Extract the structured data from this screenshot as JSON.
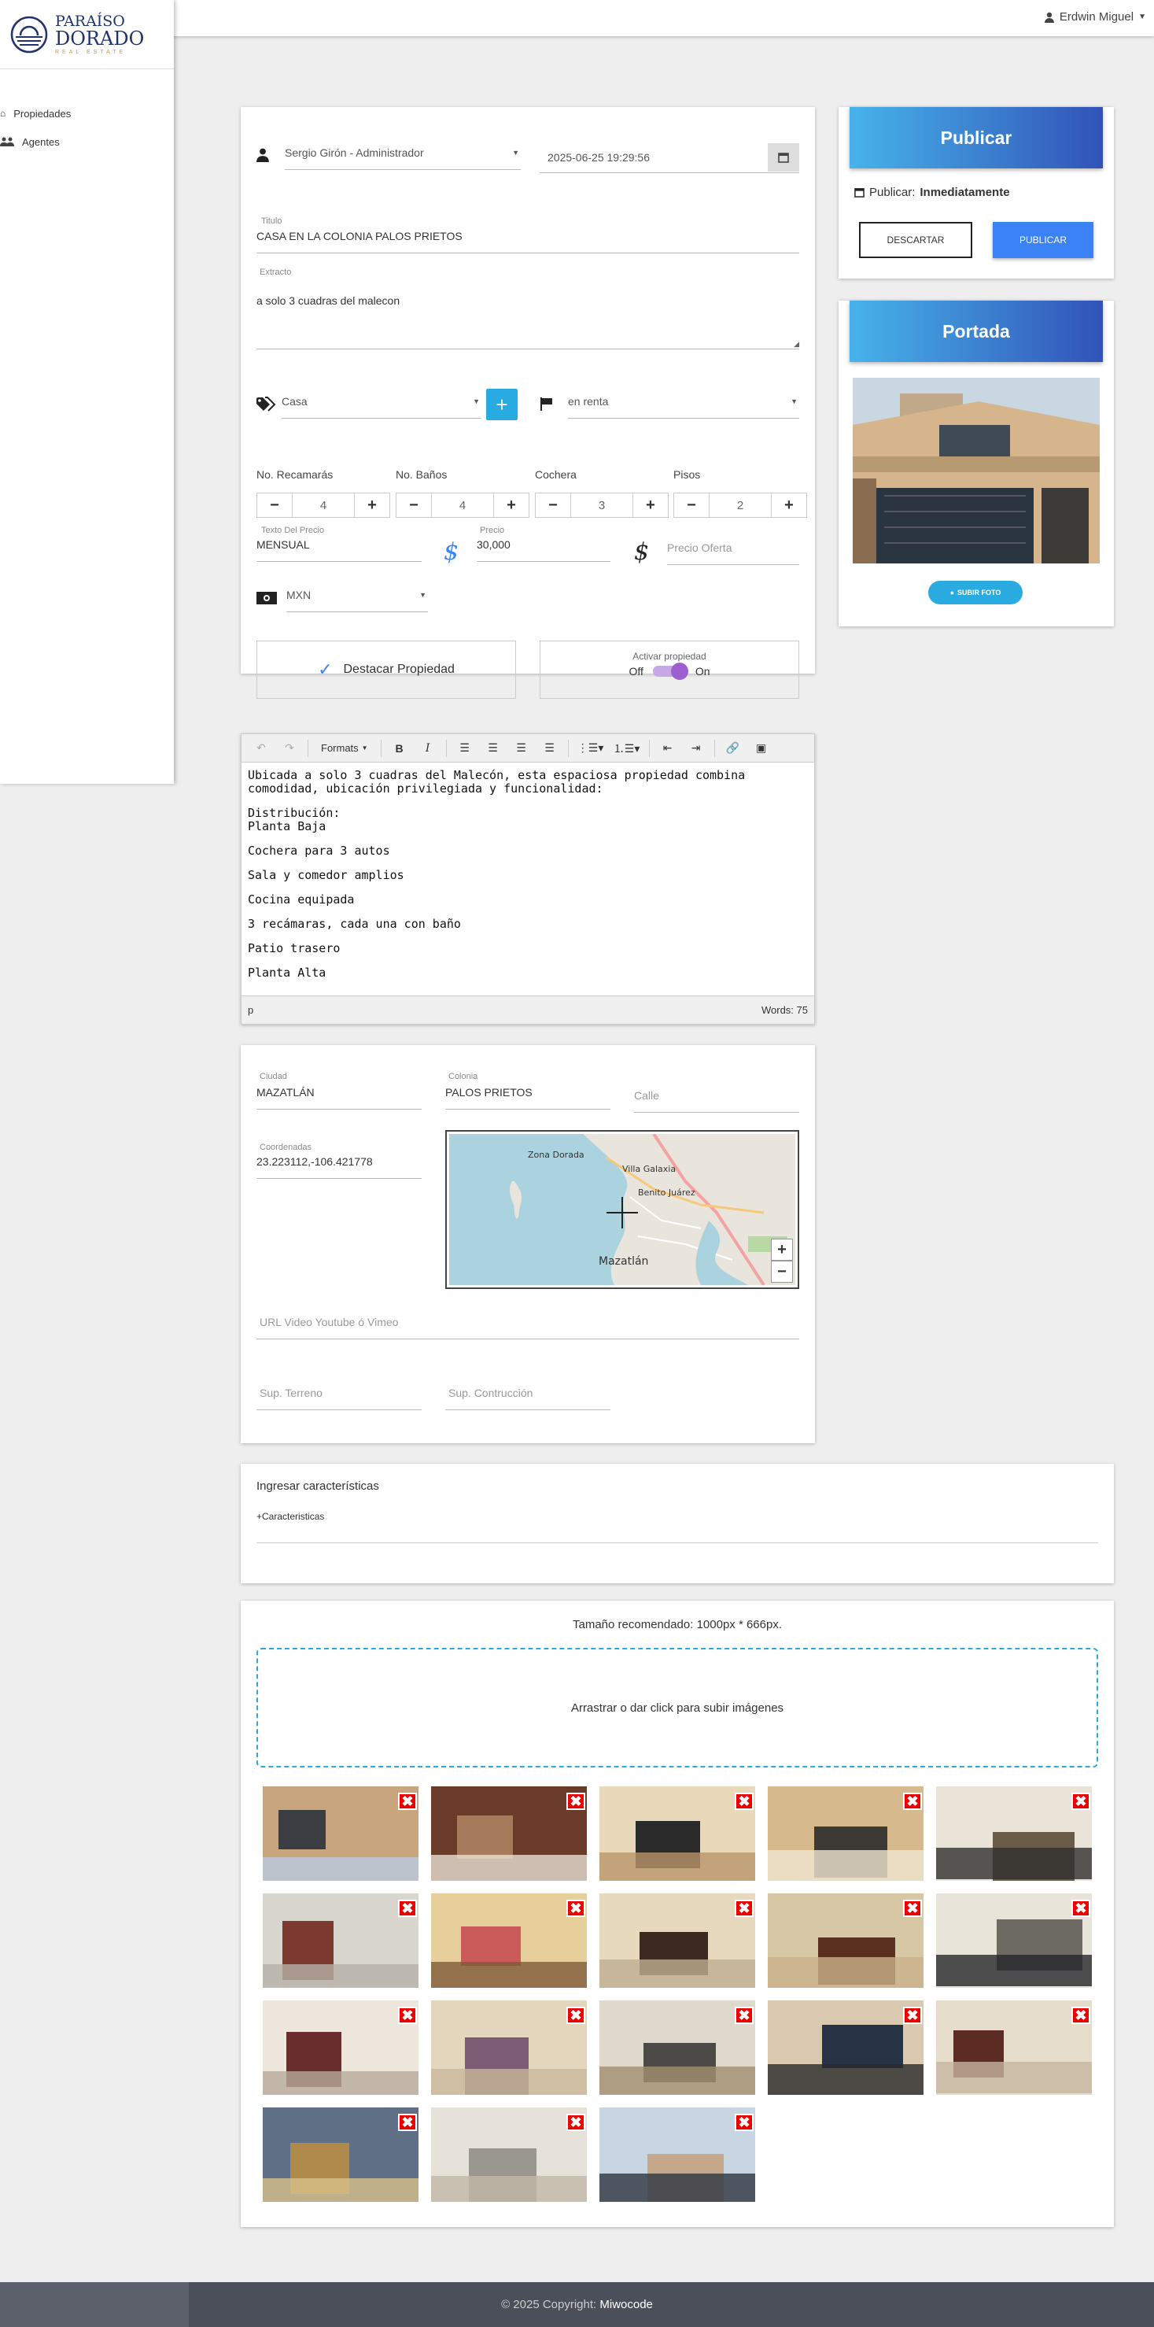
{
  "brand": {
    "line1": "PARAÍSO",
    "line2": "DORADO",
    "line3": "REAL ESTATE",
    "accent": "#22336b"
  },
  "header": {
    "user": "Erdwin Miguel"
  },
  "sidebar": {
    "items": [
      {
        "label": "Propiedades",
        "icon": "home-icon"
      },
      {
        "label": "Agentes",
        "icon": "users-icon"
      }
    ]
  },
  "form": {
    "agent": "Sergio Girón - Administrador",
    "date": "2025-06-25 19:29:56",
    "title_label": "Titulo",
    "title": "CASA EN LA COLONIA PALOS PRIETOS",
    "extract_label": "Extracto",
    "extract": "a solo 3 cuadras del malecon",
    "type": "Casa",
    "status": "en renta",
    "rooms": {
      "label": "No. Recamarás",
      "value": "4"
    },
    "baths": {
      "label": "No. Baños",
      "value": "4"
    },
    "garage": {
      "label": "Cochera",
      "value": "3"
    },
    "floors": {
      "label": "Pisos",
      "value": "2"
    },
    "price_text_label": "Texto Del Precio",
    "price_text": "MENSUAL",
    "price_label": "Precio",
    "price": "30,000",
    "offer_placeholder": "Precio Oferta",
    "currency": "MXN",
    "featured": "Destacar Propiedad",
    "activate_label": "Activar propiedad",
    "off": "Off",
    "on": "On",
    "active": true
  },
  "editor": {
    "formats": "Formats",
    "paragraphs": [
      "Ubicada a solo 3 cuadras del Malecón, esta espaciosa propiedad combina comodidad, ubicación privilegiada y funcionalidad:",
      "Distribución:\nPlanta Baja",
      "Cochera para 3 autos",
      "Sala y comedor amplios",
      "Cocina equipada",
      "3 recámaras, cada una con baño",
      "Patio trasero",
      "Planta Alta"
    ],
    "status_path": "p",
    "words": "Words: 75"
  },
  "location": {
    "city_label": "Ciudad",
    "city": "MAZATLÁN",
    "colony_label": "Colonia",
    "colony": "PALOS PRIETOS",
    "street_placeholder": "Calle",
    "coords_label": "Coordenadas",
    "coords": "23.223112,-106.421778",
    "map_labels": [
      "Zona Dorada",
      "Villa Galaxia",
      "Benito Juárez",
      "Mazatlán"
    ],
    "video_placeholder": "URL Video Youtube ó Vimeo",
    "land_placeholder": "Sup. Terreno",
    "build_placeholder": "Sup. Contrucción"
  },
  "features": {
    "title": "Ingresar características",
    "link": "+Caracteristicas"
  },
  "gallery": {
    "hint": "Tamaño recomendado: 1000px * 666px.",
    "dropzone": "Arrastrar o dar click para subir imágenes",
    "count": 18
  },
  "publish": {
    "title": "Publicar",
    "when_label": "Publicar:",
    "when": "Inmediatamente",
    "discard": "DESCARTAR",
    "publish": "PUBLICAR"
  },
  "cover": {
    "title": "Portada",
    "upload": "SUBIR FOTO"
  },
  "footer": {
    "text": "© 2025 Copyright:",
    "brand": "Miwocode"
  },
  "colors": {
    "primary": "#3b82f6",
    "accent": "#29abe2",
    "toggle": "#9c5fd0",
    "danger": "#e60000"
  }
}
